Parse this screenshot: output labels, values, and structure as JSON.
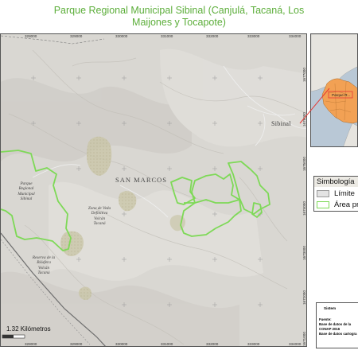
{
  "title": {
    "line1": "Parque Regional Municipal Sibinal (Canjulá, Tacaná, Los",
    "line2": "Maijones y Tocapote)"
  },
  "map": {
    "top_ticks": [
      "328000",
      "329000",
      "330000",
      "331000",
      "332000",
      "333000",
      "334000"
    ],
    "bottom_ticks": [
      "328000",
      "329000",
      "330000",
      "331000",
      "332000",
      "333000",
      "334000"
    ],
    "right_ticks": [
      "1677000",
      "1676000",
      "1675000",
      "1674000",
      "1673000",
      "1672000",
      "1671000"
    ],
    "place_sibinal": "Sibinal",
    "place_san_marcos": "SAN MARCOS",
    "park_label": [
      "Parque",
      "Regional",
      "Municipal",
      "Sibinal"
    ],
    "zona_veda_label": [
      "Zona de Veda",
      "Definitiva",
      "Volcán",
      "Tacaná"
    ],
    "reserva_label": [
      "Reserva de la",
      "Biósfera",
      "Volcán",
      "Tacaná"
    ],
    "scale_text": "1.32 Kilómetros",
    "colors": {
      "terrain": "#d9d7d2",
      "park_outline": "#7ed957",
      "veda_fill": "#c9c6a8",
      "border_dash": "#555555"
    }
  },
  "inset": {
    "label": "Parque R...",
    "colors": {
      "water": "#b9c8d6",
      "guatemala": "#f2a154",
      "neighbors": "#e6e4df",
      "marker": "#e53935"
    }
  },
  "legend": {
    "title": "Simbología",
    "items": [
      {
        "label": "Límite",
        "swatch_fill": "#e3e3e3",
        "swatch_border": "#9a9a9a"
      },
      {
        "label": "Área pr",
        "swatch_fill": "#ffffff",
        "swatch_border": "#7ed957"
      }
    ]
  },
  "info": {
    "header": "Sistem",
    "source_label": "Fuente:",
    "source_lines": [
      "Base de datos de la",
      "CONAP 2016",
      "Base de datos cartogra"
    ]
  }
}
